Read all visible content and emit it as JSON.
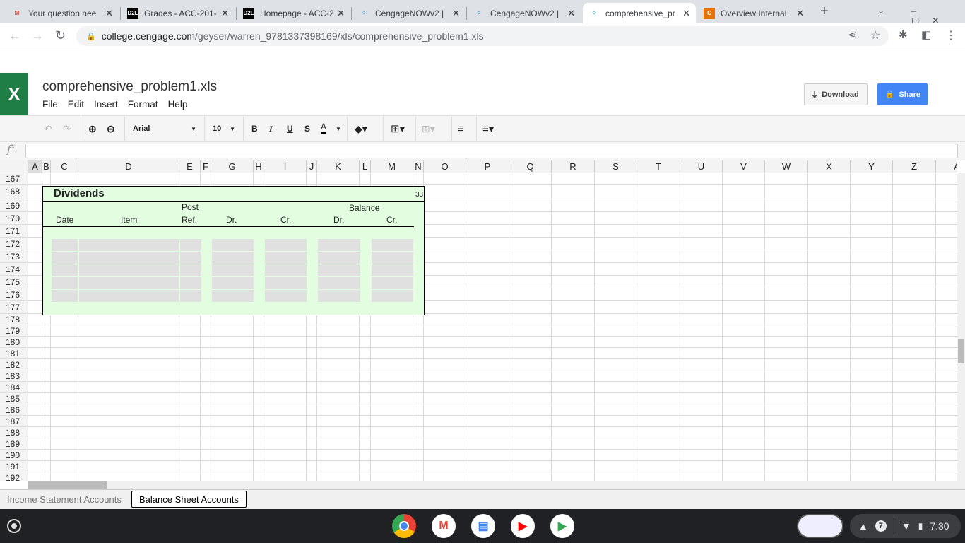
{
  "browser": {
    "tabs": [
      {
        "title": "Your question nee",
        "icon": "gmail-icon",
        "fav": "M",
        "favColor": "#ea4335",
        "favBg": "transparent"
      },
      {
        "title": "Grades - ACC-201-",
        "icon": "d2l-icon",
        "fav": "D2L",
        "favColor": "#fff",
        "favBg": "#000"
      },
      {
        "title": "Homepage - ACC-2",
        "icon": "d2l-icon",
        "fav": "D2L",
        "favColor": "#fff",
        "favBg": "#000"
      },
      {
        "title": "CengageNOWv2 |",
        "icon": "cengage-icon",
        "fav": "⁘",
        "favColor": "#1a9ed8",
        "favBg": "transparent"
      },
      {
        "title": "CengageNOWv2 |",
        "icon": "cengage-icon",
        "fav": "⁘",
        "favColor": "#1a9ed8",
        "favBg": "transparent"
      },
      {
        "title": "comprehensive_pr",
        "icon": "cengage-icon",
        "fav": "⁘",
        "favColor": "#1a9ed8",
        "favBg": "transparent",
        "active": true
      },
      {
        "title": "Overview Internal",
        "icon": "c-icon",
        "fav": "C",
        "favColor": "#fff",
        "favBg": "#e8710a"
      }
    ],
    "url_host": "college.cengage.com",
    "url_path": "/geyser/warren_9781337398169/xls/comprehensive_problem1.xls"
  },
  "app": {
    "logo": "X",
    "file_name": "comprehensive_problem1.xls",
    "menu": [
      "File",
      "Edit",
      "Insert",
      "Format",
      "Help"
    ],
    "download_label": "Download",
    "share_label": "Share",
    "accent": "#4285f4",
    "brand": "#1e7e45"
  },
  "toolbar": {
    "font": "Arial",
    "size": "10",
    "bold": "B",
    "italic": "I",
    "underline": "U",
    "strike": "S",
    "text_color": "A"
  },
  "formula": {
    "fx": "f",
    "fx_sup": "x",
    "value": ""
  },
  "columns": [
    "A",
    "B",
    "C",
    "D",
    "E",
    "F",
    "G",
    "H",
    "I",
    "J",
    "K",
    "L",
    "M",
    "N",
    "O",
    "P",
    "Q",
    "R",
    "S",
    "T",
    "U",
    "V",
    "W",
    "X",
    "Y",
    "Z",
    "A"
  ],
  "rows": [
    "167",
    "168",
    "169",
    "170",
    "171",
    "172",
    "173",
    "174",
    "175",
    "176",
    "177",
    "178",
    "179",
    "180",
    "181",
    "182",
    "183",
    "184",
    "185",
    "186",
    "187",
    "188",
    "189",
    "190",
    "191",
    "192"
  ],
  "form": {
    "title": "Dividends",
    "account_no": "33",
    "post": "Post",
    "balance": "Balance",
    "headers": [
      "Date",
      "Item",
      "Ref.",
      "Dr.",
      "Cr.",
      "Dr.",
      "Cr."
    ],
    "fill": "#e2fde0"
  },
  "sheets": [
    {
      "label": "Income Statement Accounts",
      "active": false
    },
    {
      "label": "Balance Sheet Accounts",
      "active": true
    }
  ],
  "shelf": {
    "notifications": "7",
    "time": "7:30"
  }
}
